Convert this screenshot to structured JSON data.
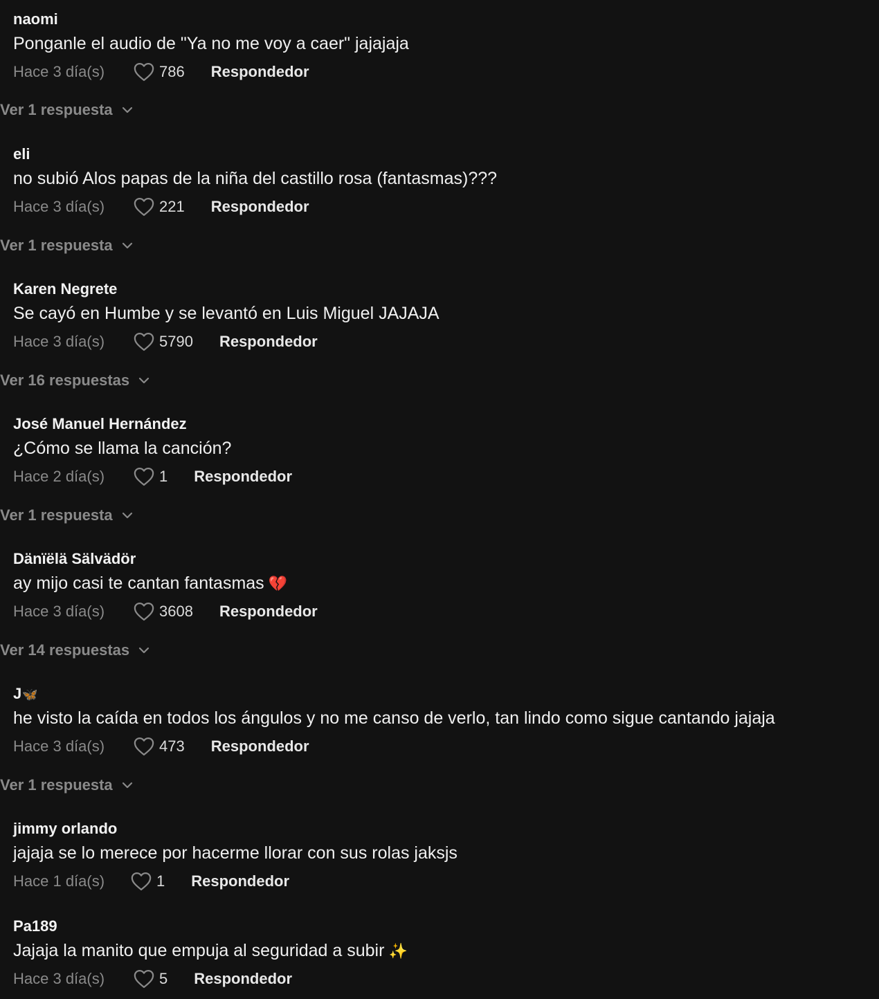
{
  "comments": [
    {
      "user": "naomi",
      "text": "Ponganle el audio de \"Ya no me voy a caer\" jajajaja",
      "time": "Hace 3 día(s)",
      "likes": "786",
      "reply_label": "Respondedor",
      "view_replies": "Ver 1 respuesta"
    },
    {
      "user": "eli",
      "text": "no subió Alos papas de la niña del castillo rosa (fantasmas)???",
      "time": "Hace 3 día(s)",
      "likes": "221",
      "reply_label": "Respondedor",
      "view_replies": "Ver 1 respuesta"
    },
    {
      "user": "Karen Negrete",
      "text": "Se cayó en Humbe y se levantó en Luis Miguel JAJAJA",
      "time": "Hace 3 día(s)",
      "likes": "5790",
      "reply_label": "Respondedor",
      "view_replies": "Ver 16 respuestas"
    },
    {
      "user": "José Manuel Hernández",
      "text": "¿Cómo se llama la canción?",
      "time": "Hace 2 día(s)",
      "likes": "1",
      "reply_label": "Respondedor",
      "view_replies": "Ver 1 respuesta"
    },
    {
      "user": "Dänïëlä Sälvädör",
      "text": "ay mijo casi te cantan fantasmas",
      "text_emoji": "💔",
      "time": "Hace 3 día(s)",
      "likes": "3608",
      "reply_label": "Respondedor",
      "view_replies": "Ver 14 respuestas"
    },
    {
      "user": "J",
      "user_emoji": "🦋",
      "text": "he visto la caída en todos los ángulos y no me canso de verlo, tan lindo como sigue cantando jajaja",
      "time": "Hace 3 día(s)",
      "likes": "473",
      "reply_label": "Respondedor",
      "view_replies": "Ver 1 respuesta"
    },
    {
      "user": "jimmy orlando",
      "text": "jajaja se lo merece por hacerme llorar con sus rolas jaksjs",
      "time": "Hace 1 día(s)",
      "likes": "1",
      "reply_label": "Respondedor"
    },
    {
      "user": "Pa189",
      "text": "Jajaja la manito que empuja al seguridad a subir",
      "text_emoji": "✨",
      "time": "Hace 3 día(s)",
      "likes": "5",
      "reply_label": "Respondedor"
    }
  ],
  "icons": {
    "like": "heart-outline-icon",
    "expand": "chevron-down-icon"
  },
  "colors": {
    "background": "#121212",
    "muted_text": "#8a8a8a",
    "primary_text": "#ffffff"
  }
}
